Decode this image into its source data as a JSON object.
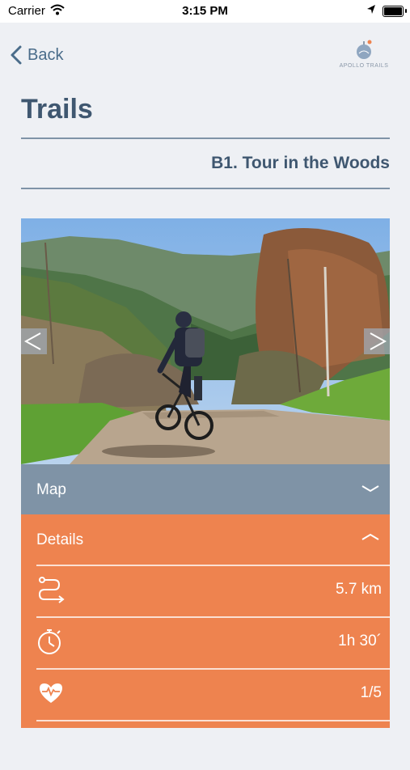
{
  "status_bar": {
    "carrier": "Carrier",
    "time": "3:15 PM"
  },
  "nav": {
    "back_label": "Back"
  },
  "logo": {
    "text": "APOLLO TRAILS"
  },
  "page": {
    "title": "Trails",
    "trail_name": "B1. Tour in the Woods"
  },
  "photo": {
    "prev_arrow": "<",
    "next_arrow": ">"
  },
  "map": {
    "label": "Map"
  },
  "details": {
    "label": "Details",
    "rows": [
      {
        "icon": "route-icon",
        "value": "5.7 km"
      },
      {
        "icon": "stopwatch-icon",
        "value": "1h 30´"
      },
      {
        "icon": "heartbeat-icon",
        "value": "1/5"
      }
    ]
  },
  "colors": {
    "title": "#3f5770",
    "back": "#4a6c8a",
    "map_bar": "#7f93a6",
    "details_bar": "#ee834f",
    "background": "#eef0f4"
  }
}
